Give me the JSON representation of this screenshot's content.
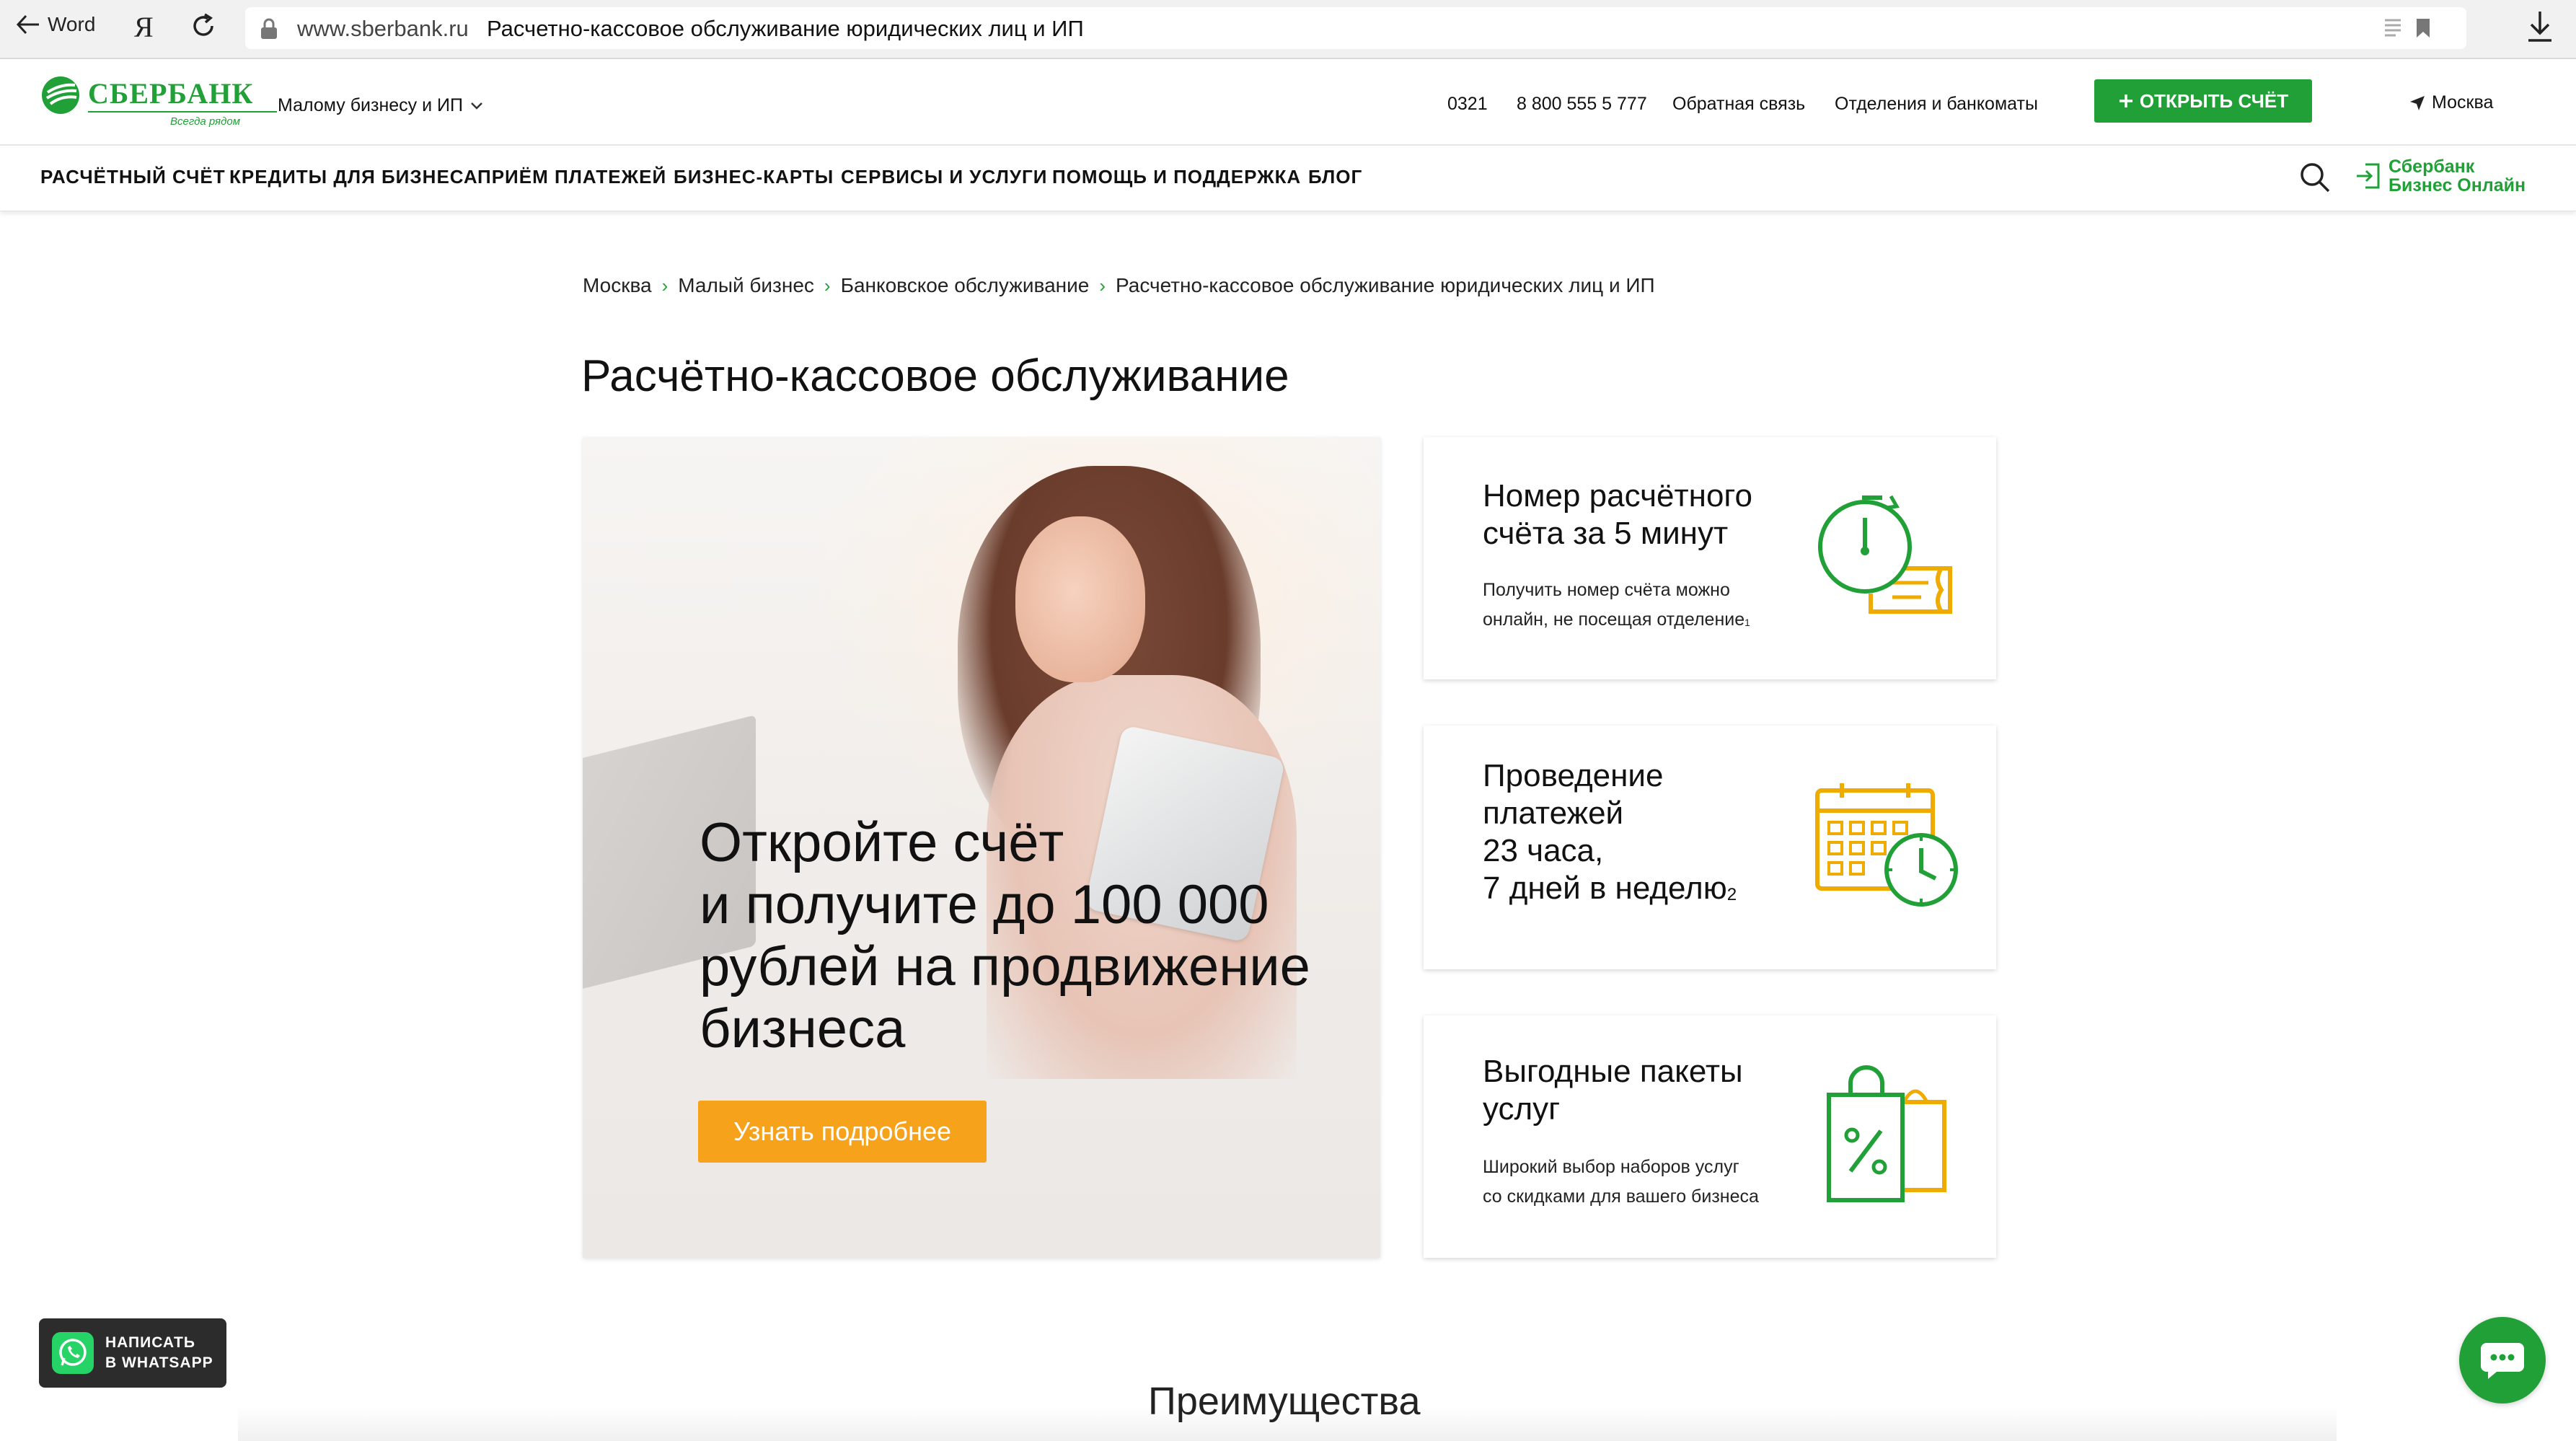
{
  "browser": {
    "back_label": "Word",
    "yandex_icon": "Я",
    "domain": "www.sberbank.ru",
    "page_title": "Расчетно-кассовое обслуживание юридических лиц и ИП",
    "icons": [
      "arrow-left-icon",
      "refresh-icon",
      "lock-icon",
      "reader-icon",
      "bookmark-icon",
      "download-icon"
    ]
  },
  "header": {
    "logo_text": "СБЕРБАНК",
    "logo_slogan": "Всегда рядом",
    "segment": "Малому бизнесу и ИП",
    "links": [
      "0321",
      "8 800 555 5 777",
      "Обратная связь",
      "Отделения и банкоматы"
    ],
    "open_account": "ОТКРЫТЬ СЧЁТ",
    "city": "Москва"
  },
  "nav": {
    "items": [
      "РАСЧЁТНЫЙ СЧЁТ",
      "КРЕДИТЫ ДЛЯ БИЗНЕСА",
      "ПРИЁМ ПЛАТЕЖЕЙ",
      "БИЗНЕС-КАРТЫ",
      "СЕРВИСЫ И УСЛУГИ",
      "ПОМОЩЬ И ПОДДЕРЖКА",
      "БЛОГ"
    ],
    "biz_online_line1": "Сбербанк",
    "biz_online_line2": "Бизнес Онлайн"
  },
  "breadcrumbs": [
    "Москва",
    "Малый бизнес",
    "Банковское обслуживание",
    "Расчетно-кассовое обслуживание юридических лиц и ИП"
  ],
  "page_title": "Расчётно-кассовое обслуживание",
  "hero": {
    "headline_lines": [
      "Откройте счёт",
      "и получите до 100 000",
      "рублей на продвижение",
      "бизнеса"
    ],
    "cta": "Узнать подробнее"
  },
  "cards": [
    {
      "title_lines": [
        "Номер расчётного",
        "счёта за 5 минут"
      ],
      "desc_lines": [
        "Получить номер счёта можно",
        "онлайн, не посещая отделение"
      ],
      "footnote": "1",
      "icon": "stopwatch-ticket-icon"
    },
    {
      "title_lines": [
        "Проведение",
        "платежей",
        "23 часа,",
        "7 дней в неделю"
      ],
      "footnote": "2",
      "icon": "calendar-clock-icon"
    },
    {
      "title_lines": [
        "Выгодные пакеты",
        "услуг"
      ],
      "desc_lines": [
        "Широкий выбор наборов услуг",
        "со скидками для вашего бизнеса"
      ],
      "icon": "shopping-bag-percent-icon"
    }
  ],
  "advantages_title": "Преимущества",
  "whatsapp": {
    "line1": "НАПИСАТЬ",
    "line2": "В WHATSAPP"
  },
  "colors": {
    "brand_green": "#21a038",
    "accent_orange": "#f7a21b",
    "icon_yellow": "#f0ab00"
  }
}
